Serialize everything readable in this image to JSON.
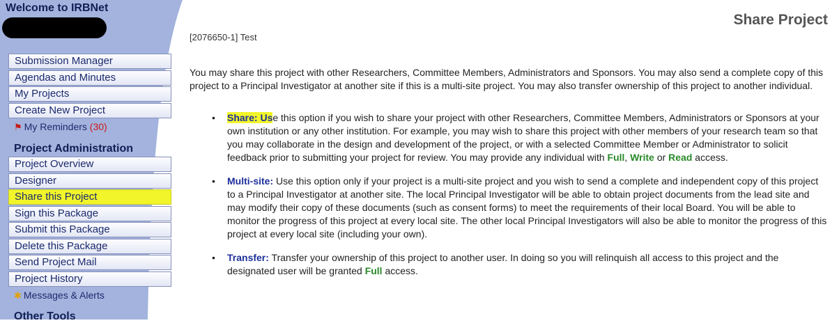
{
  "sidebar": {
    "welcome": "Welcome to IRBNet",
    "menu_top": [
      "Submission Manager",
      "Agendas and Minutes",
      "My Projects",
      "Create New Project"
    ],
    "reminders": {
      "label": "My Reminders",
      "count": "(30)"
    },
    "project_admin_heading": "Project Administration",
    "admin_items": [
      "Project Overview",
      "Designer",
      "Share this Project",
      "Sign this Package",
      "Submit this Package",
      "Delete this Package",
      "Send Project Mail",
      "Project History"
    ],
    "messages_label": "Messages & Alerts",
    "other_tools_heading": "Other Tools",
    "colors": {
      "sidebar_bg": "#a4b3dd",
      "highlight": "#f1f52a"
    }
  },
  "main": {
    "title": "Share Project",
    "project_id": "[2076650-1] Test",
    "intro": "You may share this project with other Researchers, Committee Members, Administrators and Sponsors. You may also send a complete copy of this project to a Principal Investigator at another site if this is a multi-site project. You may also transfer ownership of this project to another individual.",
    "options": [
      {
        "title_hl": "Share: Us",
        "text": "e this option if you wish to share your project with other Researchers, Committee Members, Administrators or Sponsors at your own institution or any other institution. For example, you may wish to share this project with other members of your research team so that you may collaborate in the design and development of the project, or with a selected Committee Member or Administrator to solicit feedback prior to submitting your project for review. You may provide any individual with ",
        "access_full": "Full",
        "sep1": ", ",
        "access_write": "Write",
        "sep2": " or ",
        "access_read": "Read",
        "end": " access."
      },
      {
        "title": "Multi-site:",
        "text": " Use this option only if your project is a multi-site project and you wish to send a complete and independent copy of this project to a Principal Investigator at another site. The local Principal Investigator will be able to obtain project documents from the lead site and may modify their copy of these documents (such as consent forms) to meet the requirements of their local Board. You will be able to monitor the progress of this project at every local site. The other local Principal Investigators will also be able to monitor the progress of this project at every local site (including your own)."
      },
      {
        "title": "Transfer:",
        "text": " Transfer your ownership of this project to another user. In doing so you will relinquish all access to this project and the designated user will be granted ",
        "access_full": "Full",
        "end": " access."
      }
    ]
  }
}
